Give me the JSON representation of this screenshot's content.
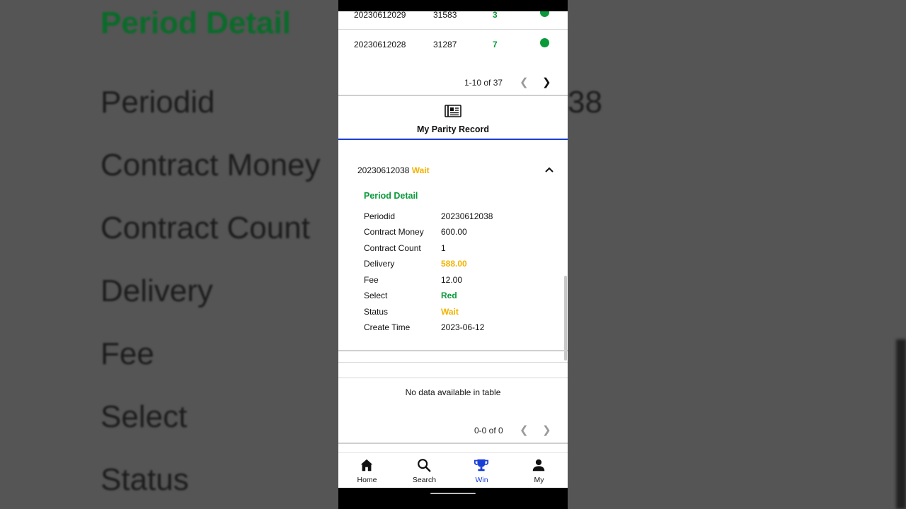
{
  "background": {
    "title": "Period Detail",
    "labels": [
      "Periodid",
      "Contract Money",
      "Contract Count",
      "Delivery",
      "Fee",
      "Select",
      "Status"
    ],
    "right_fragment": "38"
  },
  "records_table": {
    "rows": [
      {
        "period": "20230612029",
        "price": "31583",
        "number": "3"
      },
      {
        "period": "20230612028",
        "price": "31287",
        "number": "7"
      }
    ],
    "pager_text": "1-10 of 37"
  },
  "tab": {
    "label": "My Parity Record",
    "icon": "newspaper-icon"
  },
  "record": {
    "period": "20230612038",
    "status": "Wait",
    "detail_title": "Period Detail",
    "fields": [
      {
        "key": "Periodid",
        "value": "20230612038"
      },
      {
        "key": "Contract Money",
        "value": "600.00"
      },
      {
        "key": "Contract Count",
        "value": "1"
      },
      {
        "key": "Delivery",
        "value": "588.00"
      },
      {
        "key": "Fee",
        "value": "12.00"
      },
      {
        "key": "Select",
        "value": "Red"
      },
      {
        "key": "Status",
        "value": "Wait"
      },
      {
        "key": "Create Time",
        "value": "2023-06-12"
      }
    ]
  },
  "second_table": {
    "empty_text": "No data available in table",
    "pager_text": "0-0 of 0"
  },
  "bottom_nav": [
    {
      "label": "Home",
      "icon": "home-icon"
    },
    {
      "label": "Search",
      "icon": "search-icon"
    },
    {
      "label": "Win",
      "icon": "trophy-icon"
    },
    {
      "label": "My",
      "icon": "person-icon"
    }
  ],
  "colors": {
    "accent_blue": "#1a3fd6",
    "green": "#0a9a3a",
    "gold": "#f2b300"
  }
}
